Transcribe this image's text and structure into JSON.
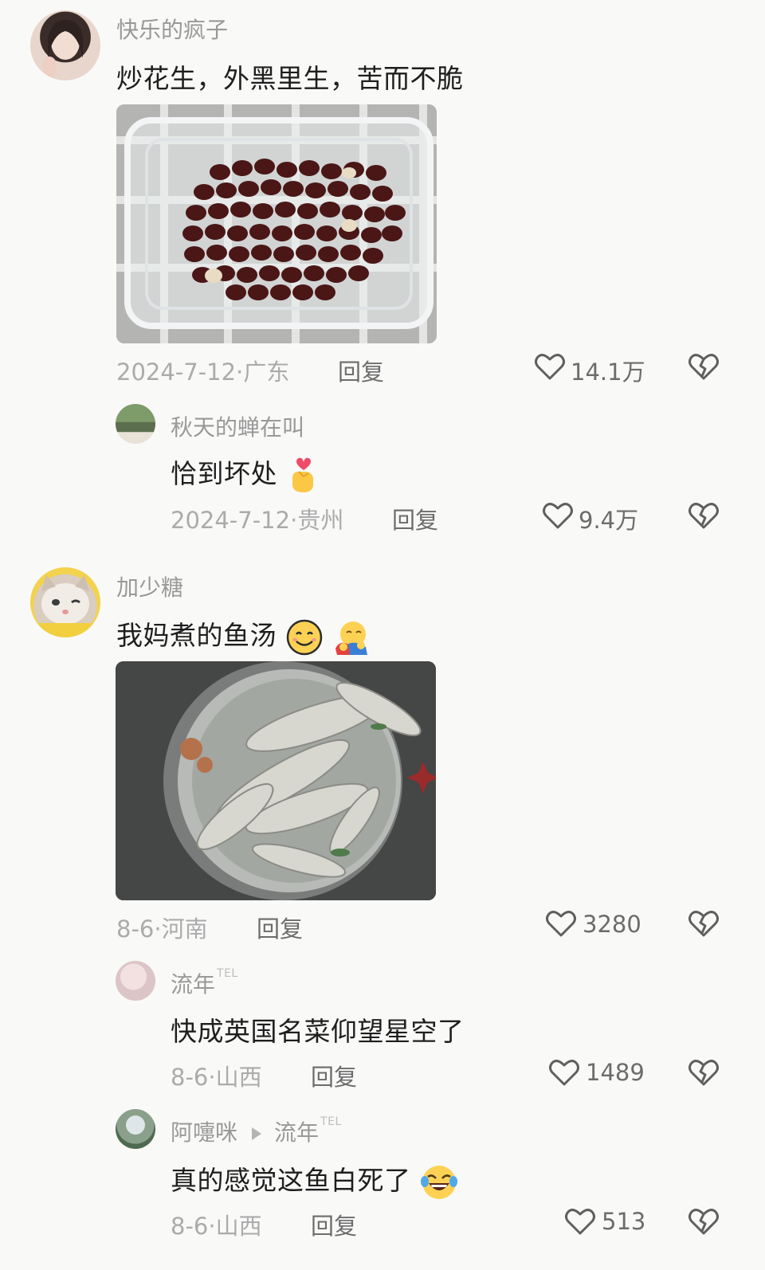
{
  "comments": [
    {
      "username": "快乐的疯子",
      "text": "炒花生，外黑里生，苦而不脆",
      "image": "roasted-peanuts-in-glass-container",
      "date": "2024-7-12",
      "location": "广东",
      "reply_label": "回复",
      "likes": "14.1万"
    },
    {
      "username": "秋天的蝉在叫",
      "text": "恰到坏处",
      "emoji": "finger-heart-emoji",
      "date": "2024-7-12",
      "location": "贵州",
      "reply_label": "回复",
      "likes": "9.4万"
    },
    {
      "username": "加少糖",
      "text": "我妈煮的鱼汤",
      "emojis": [
        "smiling-face-emoji",
        "hugging-face-emoji"
      ],
      "image": "fish-soup-in-pot",
      "date": "8-6",
      "location": "河南",
      "reply_label": "回复",
      "likes": "3280"
    },
    {
      "username": "流年",
      "badge": "TEL",
      "text": "快成英国名菜仰望星空了",
      "date": "8-6",
      "location": "山西",
      "reply_label": "回复",
      "likes": "1489"
    },
    {
      "username": "阿嚏咪",
      "reply_to": "流年",
      "badge": "TEL",
      "text": "真的感觉这鱼白死了",
      "emoji": "rolling-laughing-emoji",
      "date": "8-6",
      "location": "山西",
      "reply_label": "回复",
      "likes": "513"
    }
  ],
  "colors": {
    "background": "#f9f9f8",
    "text": "#1e1e1e",
    "username": "#999999",
    "meta": "#ababab",
    "action": "#6c6c6c"
  }
}
